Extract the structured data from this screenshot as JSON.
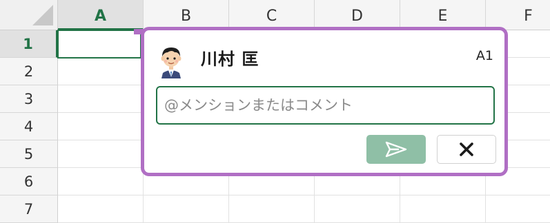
{
  "spreadsheet": {
    "columns": [
      "A",
      "B",
      "C",
      "D",
      "E",
      "F"
    ],
    "rows": [
      "1",
      "2",
      "3",
      "4",
      "5",
      "6",
      "7"
    ],
    "selected_column": "A",
    "selected_row": "1"
  },
  "comment": {
    "user_name": "川村 匡",
    "cell_ref": "A1",
    "input_placeholder": "@メンションまたはコメント",
    "input_value": "",
    "send_icon": "send-icon",
    "cancel_icon": "close-icon"
  },
  "colors": {
    "accent_green": "#217346",
    "comment_border": "#b06fc4",
    "send_button_disabled": "#8fbfa6"
  }
}
